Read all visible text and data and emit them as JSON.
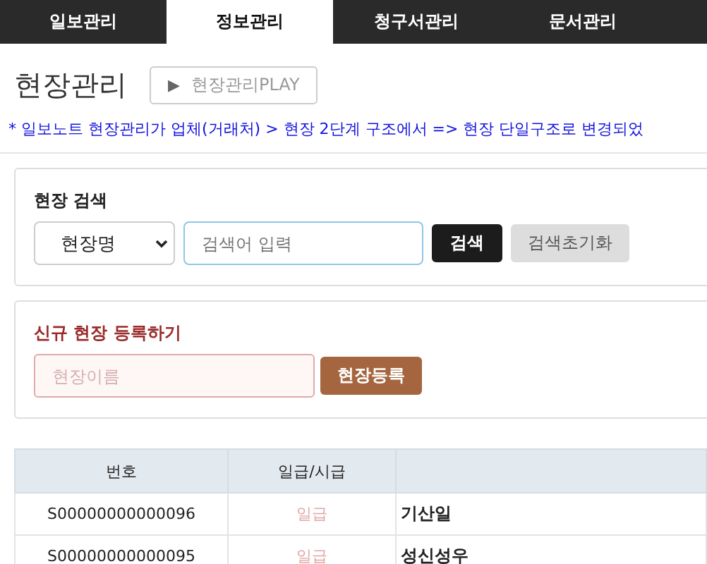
{
  "tabs": [
    {
      "label": "일보관리",
      "selected": false
    },
    {
      "label": "정보관리",
      "selected": true
    },
    {
      "label": "청구서관리",
      "selected": false
    },
    {
      "label": "문서관리",
      "selected": false
    }
  ],
  "page_title": "현장관리",
  "play_button": {
    "icon": "▶",
    "label": "현장관리PLAY"
  },
  "notice": "* 일보노트 현장관리가 업체(거래처) > 현장 2단계 구조에서 => 현장 단일구조로 변경되었",
  "search": {
    "title": "현장 검색",
    "select_value": "현장명",
    "placeholder": "검색어 입력",
    "search_button": "검색",
    "reset_button": "검색초기화"
  },
  "register": {
    "title": "신규 현장 등록하기",
    "placeholder": "현장이름",
    "button": "현장등록"
  },
  "table": {
    "columns": [
      "번호",
      "일급/시급"
    ],
    "rows": [
      {
        "number": "S00000000000096",
        "pay_type": "일급",
        "name": "기산일"
      },
      {
        "number": "S00000000000095",
        "pay_type": "일급",
        "name": "성신성우"
      }
    ]
  }
}
